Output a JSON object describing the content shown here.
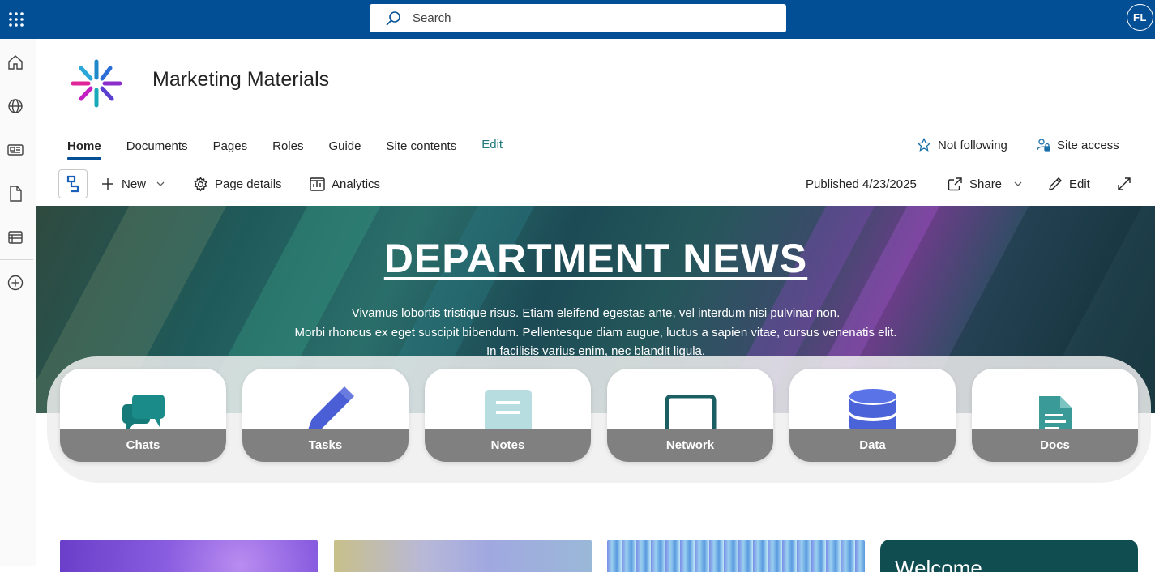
{
  "suite": {
    "search_placeholder": "Search",
    "avatar_initials": "FL",
    "bar_color": "#034f96"
  },
  "appbar": {
    "icons": [
      "home-icon",
      "globe-icon",
      "news-icon",
      "document-icon",
      "list-icon",
      "add-circle-icon"
    ]
  },
  "site": {
    "title": "Marketing Materials"
  },
  "nav": {
    "items": [
      "Home",
      "Documents",
      "Pages",
      "Roles",
      "Guide",
      "Site contents"
    ],
    "edit_label": "Edit",
    "not_following_label": "Not following",
    "site_access_label": "Site access"
  },
  "command_bar": {
    "new_label": "New",
    "page_details_label": "Page details",
    "analytics_label": "Analytics",
    "published_label": "Published 4/23/2025",
    "share_label": "Share",
    "edit_label": "Edit"
  },
  "hero": {
    "title": "DEPARTMENT NEWS",
    "lines": [
      "Vivamus lobortis tristique risus. Etiam eleifend egestas ante, vel interdum nisi pulvinar non.",
      "Morbi rhoncus ex eget suscipit bibendum. Pellentesque diam augue, luctus a sapien vitae, cursus venenatis elit.",
      "In facilisis varius enim, nec blandit ligula."
    ]
  },
  "tiles": [
    {
      "label": "Chats",
      "icon": "chat-bubbles-icon",
      "color": "#167a78"
    },
    {
      "label": "Tasks",
      "icon": "pencil-icon",
      "color": "#4a5fd6"
    },
    {
      "label": "Notes",
      "icon": "notebook-icon",
      "color": "#b8dde0"
    },
    {
      "label": "Network",
      "icon": "laptop-icon",
      "color": "#1b5f63"
    },
    {
      "label": "Data",
      "icon": "database-icon",
      "color": "#4a63d8"
    },
    {
      "label": "Docs",
      "icon": "document-icon",
      "color": "#3a9a98"
    }
  ],
  "cards": {
    "welcome_text": "Welcome"
  }
}
